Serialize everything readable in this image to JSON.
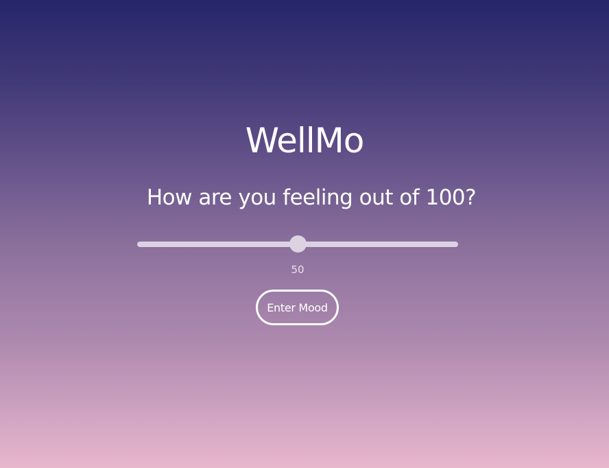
{
  "app": {
    "title": "WellMo"
  },
  "mood": {
    "question": "How are you feeling out of 100?",
    "slider_min": 0,
    "slider_max": 100,
    "value": 50,
    "value_label": "50",
    "submit_label": "Enter Mood"
  },
  "colors": {
    "gradient_top": "#26266a",
    "gradient_bottom": "#e8b7cd",
    "track": "#dcd2e2"
  }
}
